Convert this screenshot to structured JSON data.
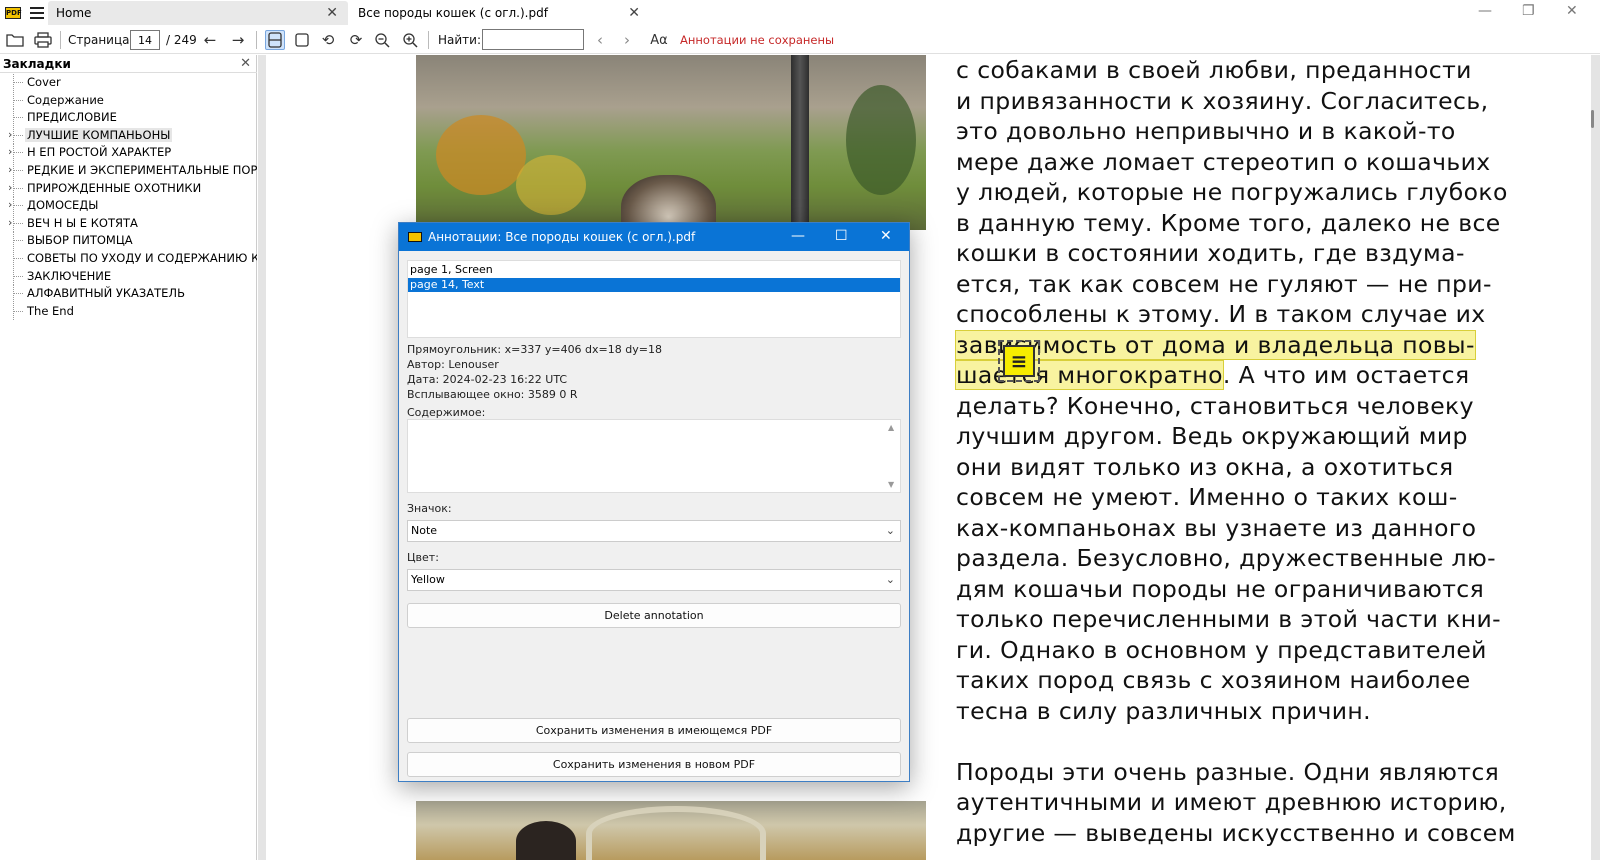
{
  "tabs": {
    "home": "Home",
    "document": "Все породы кошек (с огл.).pdf"
  },
  "toolbar": {
    "page_label": "Страница:",
    "page_current": "14",
    "page_total": "/ 249",
    "find_label": "Найти:",
    "find_value": "",
    "font_glyph": "Aα",
    "status": "Аннотации не сохранены",
    "status_color": "#c62828"
  },
  "bookmarks": {
    "title": "Закладки",
    "items": [
      {
        "label": "Cover",
        "expandable": false
      },
      {
        "label": "Содержание",
        "expandable": false
      },
      {
        "label": "ПРЕДИСЛОВИЕ",
        "expandable": false
      },
      {
        "label": "ЛУЧШИЕ КОМПАНЬОНЫ",
        "expandable": true,
        "selected": true
      },
      {
        "label": "Н ЕП РОСТОЙ ХАРАКТЕР",
        "expandable": true
      },
      {
        "label": "РЕДКИЕ И ЭКСПЕРИМЕНТАЛЬНЫЕ ПОРОДЫ",
        "expandable": true
      },
      {
        "label": "ПРИРОЖДЕННЫЕ ОХОТНИКИ",
        "expandable": true
      },
      {
        "label": "ДОМОСЕДЫ",
        "expandable": true
      },
      {
        "label": "ВЕЧ Н Ы Е КОТЯТА",
        "expandable": true
      },
      {
        "label": "ВЫБОР ПИТОМЦА",
        "expandable": false
      },
      {
        "label": "СОВЕТЫ ПО УХОДУ И СОДЕРЖАНИЮ КОШЕК",
        "expandable": false
      },
      {
        "label": "ЗАКЛЮЧЕНИЕ",
        "expandable": false
      },
      {
        "label": "АЛФАВИТНЫЙ УКАЗАТЕЛЬ",
        "expandable": false
      },
      {
        "label": "The End",
        "expandable": false
      }
    ]
  },
  "document": {
    "highlight_color": "#f8f3a0",
    "lines": [
      "с собаками в своей любви, преданности",
      "и привязанности к хозяину. Согласитесь,",
      "это довольно непривычно и в какой-то",
      "мере даже ломает стереотип о кошачьих",
      "у людей, которые не погружались глубоко",
      "в данную тему. Кроме того, далеко не все",
      "кошки в состоянии ходить, где вздума-",
      "ется, так как совсем не гуляют — не при-",
      "способлены к этому. И в таком случае их"
    ],
    "highlight_line": "зависимость от дома и владельца повы-",
    "mixed_line_highlight": "шается многократно",
    "mixed_line_rest": ". А что им остается",
    "lines_after": [
      "делать? Конечно, становиться человеку",
      "лучшим другом. Ведь окружающий мир",
      "они видят только из окна, а охотиться",
      "совсем не умеют. Именно о таких кош-",
      "ках-компаньонах вы узнаете из данного",
      "раздела. Безусловно, дружественные лю-",
      "дям кошачьи породы не ограничиваются",
      "только перечисленными в этой части кни-",
      "ги. Однако в основном у представителей",
      "таких пород связь с хозяином наиболее",
      "тесна в силу различных причин."
    ],
    "paragraph2": [
      "Породы эти очень разные. Одни являются",
      "аутентичными и имеют древнюю историю,",
      "другие — выведены искусственно и совсем"
    ]
  },
  "dialog": {
    "title": "Аннотации: Все породы кошек (с огл.).pdf",
    "annotations": [
      {
        "label": "page 1, Screen",
        "selected": false
      },
      {
        "label": "page 14, Text",
        "selected": true
      }
    ],
    "rect": "Прямоугольник: x=337 y=406 dx=18 dy=18",
    "author": "Автор: Lenouser",
    "date": "Дата: 2024-02-23 16:22 UTC",
    "popup": "Всплывающее окно: 3589 0 R",
    "content_label": "Содержимое:",
    "content_value": "",
    "icon_label": "Значок:",
    "icon_value": "Note",
    "color_label": "Цвет:",
    "color_value": "Yellow",
    "delete_button": "Delete annotation",
    "save_existing_button": "Сохранить изменения в имеющемся PDF",
    "save_new_button": "Сохранить изменения в новом PDF",
    "titlebar_color": "#0a74d6"
  }
}
